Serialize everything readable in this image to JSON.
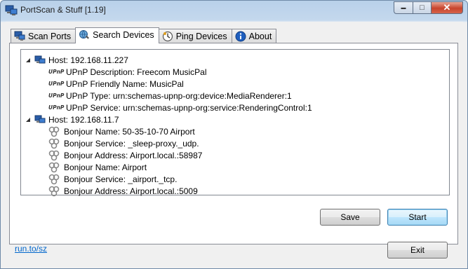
{
  "window": {
    "title": "PortScan & Stuff [1.19]",
    "caption_buttons": {
      "minimize": "▬",
      "maximize": "□",
      "close": "✕"
    }
  },
  "tabs": [
    {
      "label": "Scan Ports",
      "icon": "network-computer-icon",
      "active": false
    },
    {
      "label": "Search Devices",
      "icon": "search-globe-icon",
      "active": true
    },
    {
      "label": "Ping Devices",
      "icon": "clock-icon",
      "active": false
    },
    {
      "label": "About",
      "icon": "info-icon",
      "active": false
    }
  ],
  "tree": {
    "hosts": [
      {
        "label": "Host: 192.168.11.227",
        "expanded": true,
        "children": [
          {
            "icon": "upnp",
            "icon_text": "UPnP",
            "label": "UPnP Description: Freecom MusicPal"
          },
          {
            "icon": "upnp",
            "icon_text": "UPnP",
            "label": "UPnP Friendly Name: MusicPal"
          },
          {
            "icon": "upnp",
            "icon_text": "UPnP",
            "label": "UPnP Type: urn:schemas-upnp-org:device:MediaRenderer:1"
          },
          {
            "icon": "upnp",
            "icon_text": "UPnP",
            "label": "UPnP Service: urn:schemas-upnp-org:service:RenderingControl:1"
          }
        ]
      },
      {
        "label": "Host: 192.168.11.7",
        "expanded": true,
        "children": [
          {
            "icon": "bonjour",
            "label": "Bonjour Name: 50-35-10-70 Airport"
          },
          {
            "icon": "bonjour",
            "label": "Bonjour Service: _sleep-proxy._udp."
          },
          {
            "icon": "bonjour",
            "label": "Bonjour Address: Airport.local.:58987"
          },
          {
            "icon": "bonjour",
            "label": "Bonjour Name: Airport"
          },
          {
            "icon": "bonjour",
            "label": "Bonjour Service: _airport._tcp."
          },
          {
            "icon": "bonjour",
            "label": "Bonjour Address: Airport.local.:5009"
          }
        ]
      }
    ]
  },
  "buttons": {
    "save": "Save",
    "start": "Start",
    "exit": "Exit"
  },
  "footer": {
    "link": "run.to/sz"
  },
  "colors": {
    "link": "#0066cc",
    "title_bar": "#b9d1ea",
    "close_button": "#c8442c"
  }
}
